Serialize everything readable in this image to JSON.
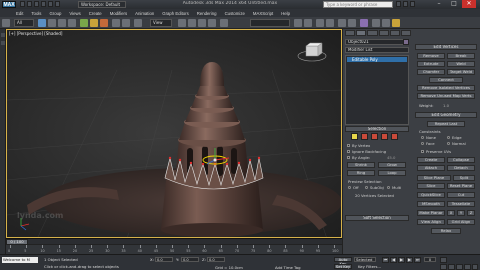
{
  "titlebar": {
    "app_icon": "MAX",
    "workspace": "Workspace: Default",
    "document_title": "Autodesk 3ds Max 2014 x64   Untitled.max",
    "search_placeholder": "Type a keyword or phrase"
  },
  "menu": [
    "Edit",
    "Tools",
    "Group",
    "Views",
    "Create",
    "Modifiers",
    "Animation",
    "Graph Editors",
    "Rendering",
    "Customize",
    "MAXScript",
    "Help"
  ],
  "toolbar": {
    "filter": "All",
    "view": "View"
  },
  "viewport": {
    "label": "[+] [Perspective] [Shaded]",
    "watermark": "lynda.com"
  },
  "command_panel": {
    "object_name": "Object021",
    "modifier_list": "Modifier List",
    "stack_item": "Editable Poly",
    "selection": {
      "header": "Selection",
      "by_vertex": "By Vertex",
      "ignore_backfacing": "Ignore Backfacing",
      "by_angle": "By Angle:",
      "angle_value": "45.0",
      "shrink": "Shrink",
      "grow": "Grow",
      "ring": "Ring",
      "loop": "Loop",
      "preview_selection": "Preview Selection",
      "off": "Off",
      "subobj": "SubObj",
      "multi": "Multi",
      "selected_count": "20 Vertices Selected"
    },
    "soft_selection": "Soft Selection",
    "edit_vertices": {
      "header": "Edit Vertices",
      "remove": "Remove",
      "break": "Break",
      "extrude": "Extrude",
      "weld": "Weld",
      "chamfer": "Chamfer",
      "target_weld": "Target Weld",
      "connect": "Connect",
      "remove_isolated": "Remove Isolated Vertices",
      "remove_unused": "Remove Unused Map Verts",
      "weight_label": "Weight:",
      "weight_value": "1.0"
    },
    "edit_geometry": {
      "header": "Edit Geometry",
      "repeat_last": "Repeat Last",
      "constraints": "Constraints",
      "none": "None",
      "edge": "Edge",
      "face": "Face",
      "normal": "Normal",
      "preserve_uvs": "Preserve UVs",
      "create": "Create",
      "collapse": "Collapse",
      "attach": "Attach",
      "detach": "Detach",
      "slice_plane": "Slice Plane",
      "split": "Split",
      "slice": "Slice",
      "reset_plane": "Reset Plane",
      "quickslice": "QuickSlice",
      "cut": "Cut",
      "msmooth": "MSmooth",
      "tessellate": "Tessellate",
      "make_planar": "Make Planar",
      "x": "X",
      "y": "Y",
      "z": "Z",
      "view_align": "View Align",
      "grid_align": "Grid Align",
      "relax": "Relax"
    }
  },
  "timeline": {
    "current": "0 / 100",
    "ticks": [
      "0",
      "5",
      "10",
      "15",
      "20",
      "25",
      "30",
      "35",
      "40",
      "45",
      "50",
      "55",
      "60",
      "65",
      "70",
      "75",
      "80",
      "85",
      "90",
      "95",
      "100"
    ]
  },
  "status": {
    "maxscript": "Welcome to M",
    "line1": "1 Object Selected",
    "line2": "Click or click-and-drag to select objects",
    "x_label": "X:",
    "x_value": "0.0",
    "y_label": "Y:",
    "y_value": "0.0",
    "z_label": "Z:",
    "z_value": "0.0",
    "grid": "Grid = 10.0cm",
    "add_time_tag": "Add Time Tag",
    "auto_key": "Auto Key",
    "selected": "Selected",
    "set_key": "Set Key",
    "key_filters": "Key Filters...",
    "frame": "0"
  },
  "colors": {
    "accent": "#2f6fa8",
    "viewport_border": "#d6b24a",
    "vertex_selected": "#e03030",
    "selection_gizmo": "#f2d600"
  }
}
